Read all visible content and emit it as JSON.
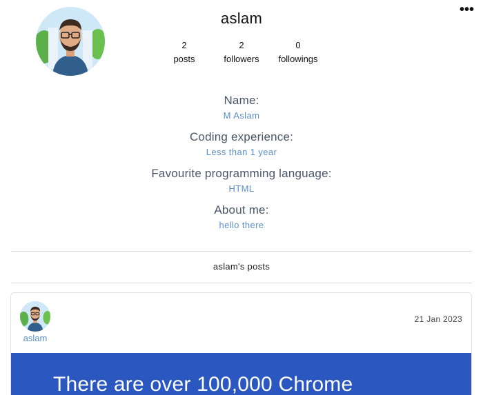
{
  "profile": {
    "username": "aslam",
    "more_icon": "more-horizontal-icon",
    "stats": {
      "posts_count": "2",
      "posts_label": "posts",
      "followers_count": "2",
      "followers_label": "followers",
      "followings_count": "0",
      "followings_label": "followings"
    }
  },
  "details": {
    "name_label": "Name:",
    "name_value": "M Aslam",
    "experience_label": "Coding experience:",
    "experience_value": "Less than 1 year",
    "language_label": "Favourite programming language:",
    "language_value": "HTML",
    "about_label": "About me:",
    "about_value": "hello there"
  },
  "posts_section": {
    "heading": "aslam's posts"
  },
  "post": {
    "author": "aslam",
    "date": "21 Jan 2023",
    "image_text": "There are over 100,000 Chrome"
  },
  "colors": {
    "link_blue": "#5b8fc7",
    "label_gray": "#4a5568",
    "post_banner_blue": "#2a58c0"
  }
}
